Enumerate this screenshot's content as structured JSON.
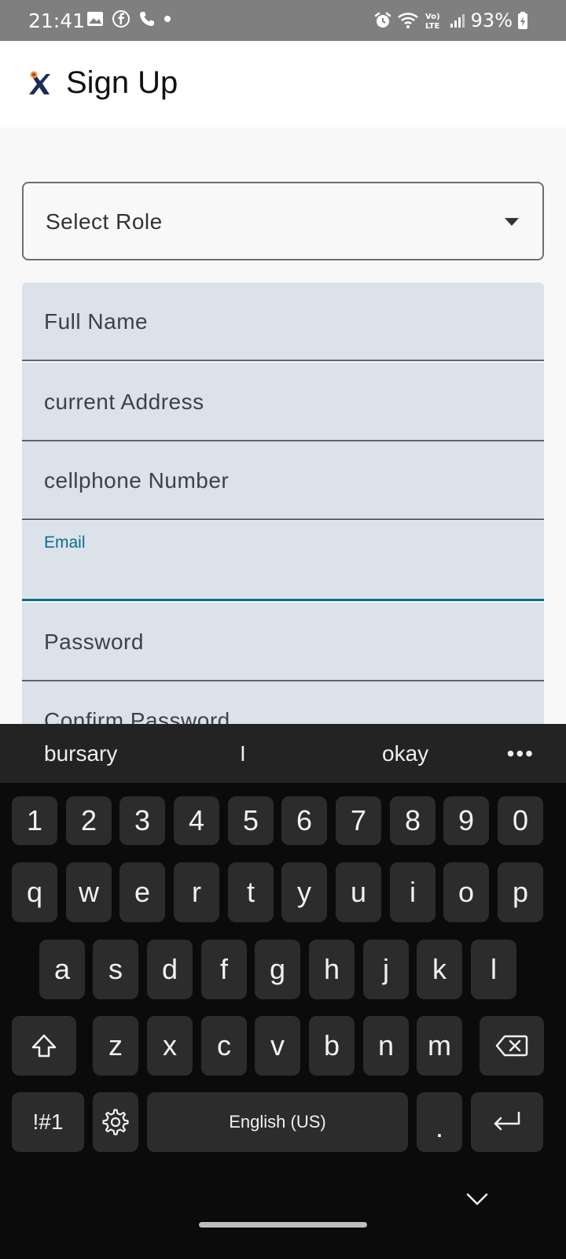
{
  "status_bar": {
    "time": "21:41",
    "battery": "93%",
    "icons": [
      "gallery-icon",
      "facebook-icon",
      "phone-icon",
      "dot-icon",
      "alarm-icon",
      "wifi-icon",
      "volte-icon",
      "signal-icon",
      "battery-icon"
    ],
    "volte_label": "Vo) LTE"
  },
  "app_bar": {
    "title": "Sign Up",
    "logo_icon": "app-logo-x-icon"
  },
  "form": {
    "role_select": {
      "placeholder": "Select Role"
    },
    "fields": {
      "full_name": "Full Name",
      "current_address": "current Address",
      "cellphone": "cellphone Number",
      "email": "Email",
      "password": "Password",
      "confirm_password": "Confirm Password"
    },
    "focused_field": "email",
    "focus_color": "#0a6d8f"
  },
  "keyboard": {
    "suggestions": [
      "bursary",
      "I",
      "okay"
    ],
    "more_label": "•••",
    "rows": {
      "numbers": [
        "1",
        "2",
        "3",
        "4",
        "5",
        "6",
        "7",
        "8",
        "9",
        "0"
      ],
      "row1": [
        "q",
        "w",
        "e",
        "r",
        "t",
        "y",
        "u",
        "i",
        "o",
        "p"
      ],
      "row2": [
        "a",
        "s",
        "d",
        "f",
        "g",
        "h",
        "j",
        "k",
        "l"
      ],
      "row3": [
        "z",
        "x",
        "c",
        "v",
        "b",
        "n",
        "m"
      ]
    },
    "symbols_key": "!#1",
    "space_label": "English (US)",
    "period_key": ".",
    "shift_icon": "shift-icon",
    "backspace_icon": "backspace-icon",
    "settings_icon": "gear-icon",
    "enter_icon": "enter-icon"
  },
  "nav": {
    "hide_keyboard_icon": "chevron-down-icon"
  }
}
